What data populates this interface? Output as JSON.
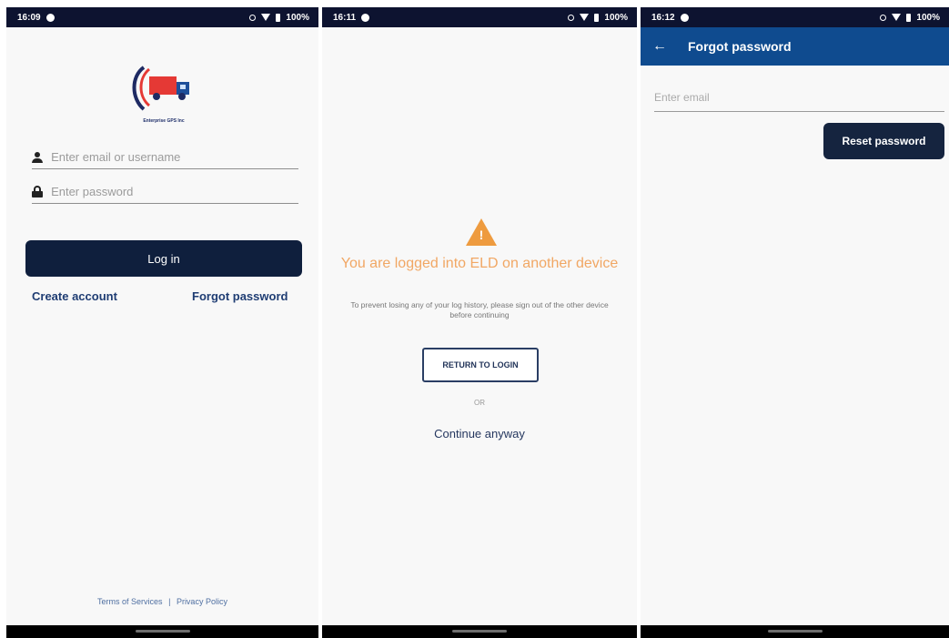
{
  "screens": [
    {
      "status": {
        "time": "16:09",
        "battery": "100%"
      },
      "logo_text": "Enterprise GPS Inc",
      "login": {
        "email_placeholder": "Enter email or username",
        "password_placeholder": "Enter password",
        "login_label": "Log in",
        "create_account": "Create account",
        "forgot_password": "Forgot password"
      },
      "footer": {
        "terms": "Terms of Services",
        "separator": "|",
        "privacy": "Privacy Policy"
      }
    },
    {
      "status": {
        "time": "16:11",
        "battery": "100%"
      },
      "warning": {
        "icon": "warning-triangle-icon",
        "title": "You are logged into ELD on another device",
        "body": "To prevent losing any of your log history, please sign out of the other device before continuing",
        "return_label": "RETURN TO LOGIN",
        "or_label": "OR",
        "continue_label": "Continue anyway"
      }
    },
    {
      "status": {
        "time": "16:12",
        "battery": "100%"
      },
      "appbar": {
        "title": "Forgot password",
        "back_icon": "arrow-left-icon"
      },
      "reset": {
        "email_placeholder": "Enter email",
        "button_label": "Reset password"
      }
    }
  ],
  "colors": {
    "status_bar": "#0d1330",
    "primary_button": "#0f1f3d",
    "app_bar": "#0f4b8f",
    "warning": "#ee9b3f",
    "link": "#1f3d73"
  }
}
